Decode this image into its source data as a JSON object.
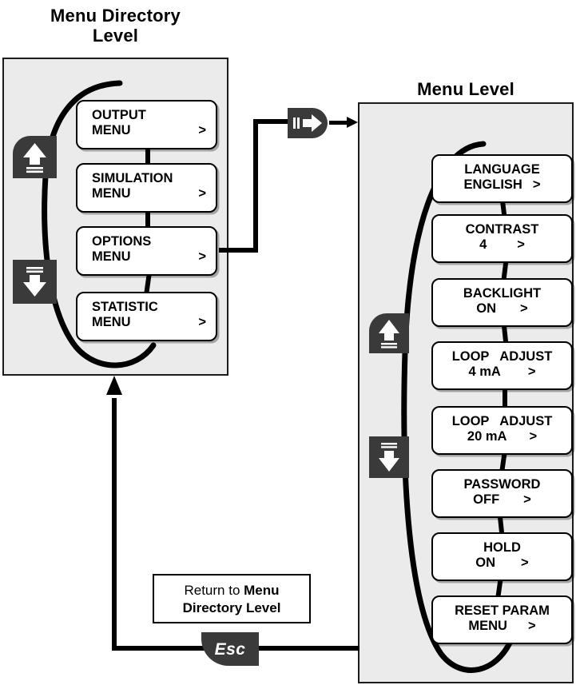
{
  "diagram": {
    "title_left": "Menu Directory\nLevel",
    "title_right": "Menu Level"
  },
  "left_panel": {
    "title_line1": "Menu Directory",
    "title_line2": "Level",
    "items": [
      {
        "label": "OUTPUT",
        "value": "MENU",
        "chevron": ">"
      },
      {
        "label": "SIMULATION",
        "value": "MENU",
        "chevron": ">"
      },
      {
        "label": "OPTIONS",
        "value": "MENU",
        "chevron": ">"
      },
      {
        "label": "STATISTIC",
        "value": "MENU",
        "chevron": ">"
      }
    ],
    "up_key": "scroll-up-key",
    "down_key": "scroll-down-key"
  },
  "right_panel": {
    "title": "Menu Level",
    "items": [
      {
        "label": "LANGUAGE",
        "value": "ENGLISH",
        "chevron": ">"
      },
      {
        "label": "CONTRAST",
        "value": "4",
        "chevron": ">"
      },
      {
        "label": "BACKLIGHT",
        "value": "ON",
        "chevron": ">"
      },
      {
        "label": "LOOP   ADJUST",
        "value": "4 mA",
        "chevron": ">"
      },
      {
        "label": "LOOP   ADJUST",
        "value": "20 mA",
        "chevron": ">"
      },
      {
        "label": "PASSWORD",
        "value": "OFF",
        "chevron": ">"
      },
      {
        "label": "HOLD",
        "value": "ON",
        "chevron": ">"
      },
      {
        "label": "RESET PARAM",
        "value": "MENU",
        "chevron": ">"
      }
    ],
    "up_key": "scroll-up-key",
    "down_key": "scroll-down-key"
  },
  "keys": {
    "enter_label": "enter-key",
    "esc_label": "Esc"
  },
  "note": {
    "prefix": "Return to ",
    "bold_line1": "Menu",
    "bold_line2": "Directory Level"
  },
  "colors": {
    "panel_fill": "#ebebeb",
    "panel_border": "#1c1c1c",
    "box_fill": "#ffffff",
    "box_border": "#000000",
    "key_fill": "#3a3a3a",
    "key_glyph": "#ffffff",
    "text": "#000000"
  }
}
